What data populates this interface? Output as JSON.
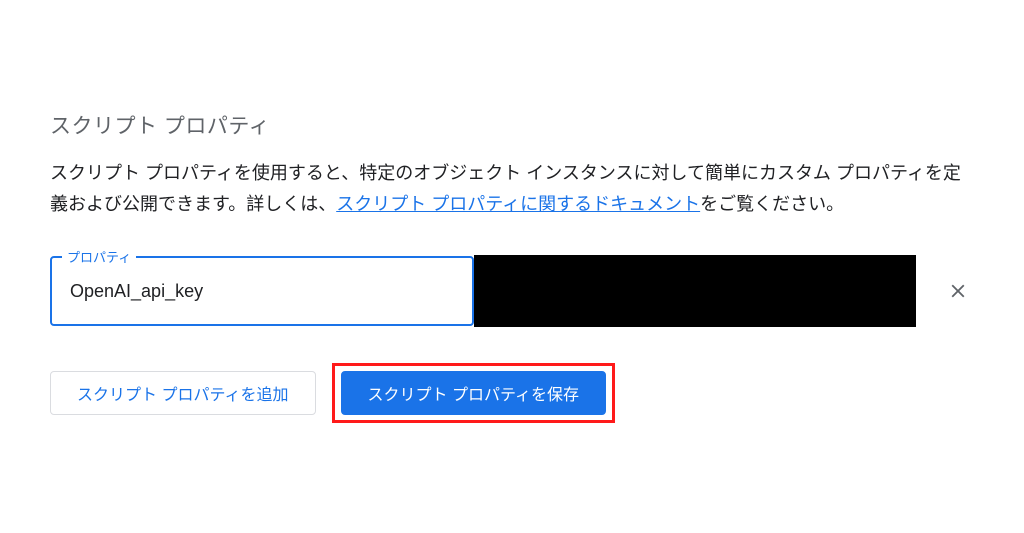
{
  "section": {
    "title": "スクリプト プロパティ",
    "description_before": "スクリプト プロパティを使用すると、特定のオブジェクト インスタンスに対して簡単にカスタム プロパティを定義および公開できます。詳しくは、",
    "description_link": "スクリプト プロパティに関するドキュメント",
    "description_after": "をご覧ください。"
  },
  "property": {
    "field_label": "プロパティ",
    "key_value": "OpenAI_api_key"
  },
  "buttons": {
    "add_label": "スクリプト プロパティを追加",
    "save_label": "スクリプト プロパティを保存"
  }
}
